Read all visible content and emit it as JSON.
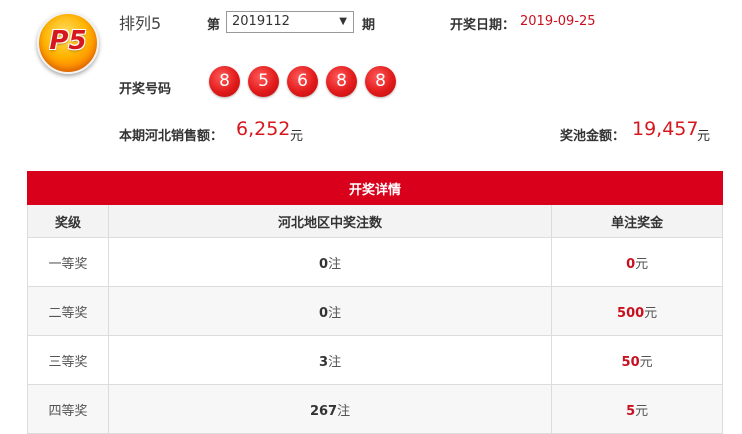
{
  "header": {
    "logo_text": "P5",
    "game_name": "排列5",
    "issue_prefix": "第",
    "issue_selected": "2019112",
    "issue_suffix": "期",
    "draw_date_label": "开奖日期：",
    "draw_date": "2019-09-25"
  },
  "draw": {
    "numbers_label": "开奖号码",
    "numbers": [
      "8",
      "5",
      "6",
      "8",
      "8"
    ]
  },
  "sales": {
    "label": "本期河北销售额：",
    "value": "6,252",
    "unit": "元"
  },
  "pool": {
    "label": "奖池金额：",
    "value": "19,457",
    "unit": "元"
  },
  "table": {
    "caption": "开奖详情",
    "headers": [
      "奖级",
      "河北地区中奖注数",
      "单注奖金"
    ],
    "count_unit": "注",
    "amount_unit": "元",
    "rows": [
      {
        "level": "一等奖",
        "count": "0",
        "amount": "0"
      },
      {
        "level": "二等奖",
        "count": "0",
        "amount": "500"
      },
      {
        "level": "三等奖",
        "count": "3",
        "amount": "50"
      },
      {
        "level": "四等奖",
        "count": "267",
        "amount": "5"
      }
    ]
  },
  "colors": {
    "accent_red": "#d8001a",
    "ball_red": "#e21b1b",
    "logo_orange": "#ffb300"
  }
}
